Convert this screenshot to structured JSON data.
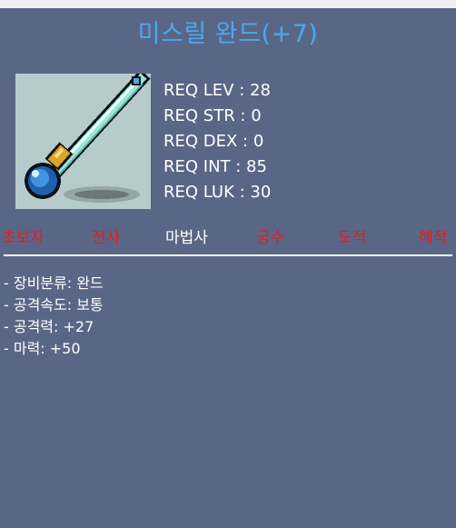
{
  "item": {
    "name": "미스릴 완드(+7)",
    "icon": "mithril-wand-icon"
  },
  "requirements": [
    "REQ LEV : 28",
    "REQ STR : 0",
    "REQ DEX : 0",
    "REQ INT : 85",
    "REQ LUK : 30"
  ],
  "jobs": [
    {
      "label": "초보자",
      "eligible": false
    },
    {
      "label": "전사",
      "eligible": false
    },
    {
      "label": "마법사",
      "eligible": true
    },
    {
      "label": "궁수",
      "eligible": false
    },
    {
      "label": "도적",
      "eligible": false
    },
    {
      "label": "해적",
      "eligible": false
    }
  ],
  "stats": [
    "- 장비분류: 완드",
    "- 공격속도: 보통",
    "- 공격력: +27",
    "- 마력: +50"
  ],
  "colors": {
    "background": "#5a6685",
    "title": "#4aa8f2",
    "job_ineligible": "#f01818",
    "job_eligible": "#ffffff"
  }
}
